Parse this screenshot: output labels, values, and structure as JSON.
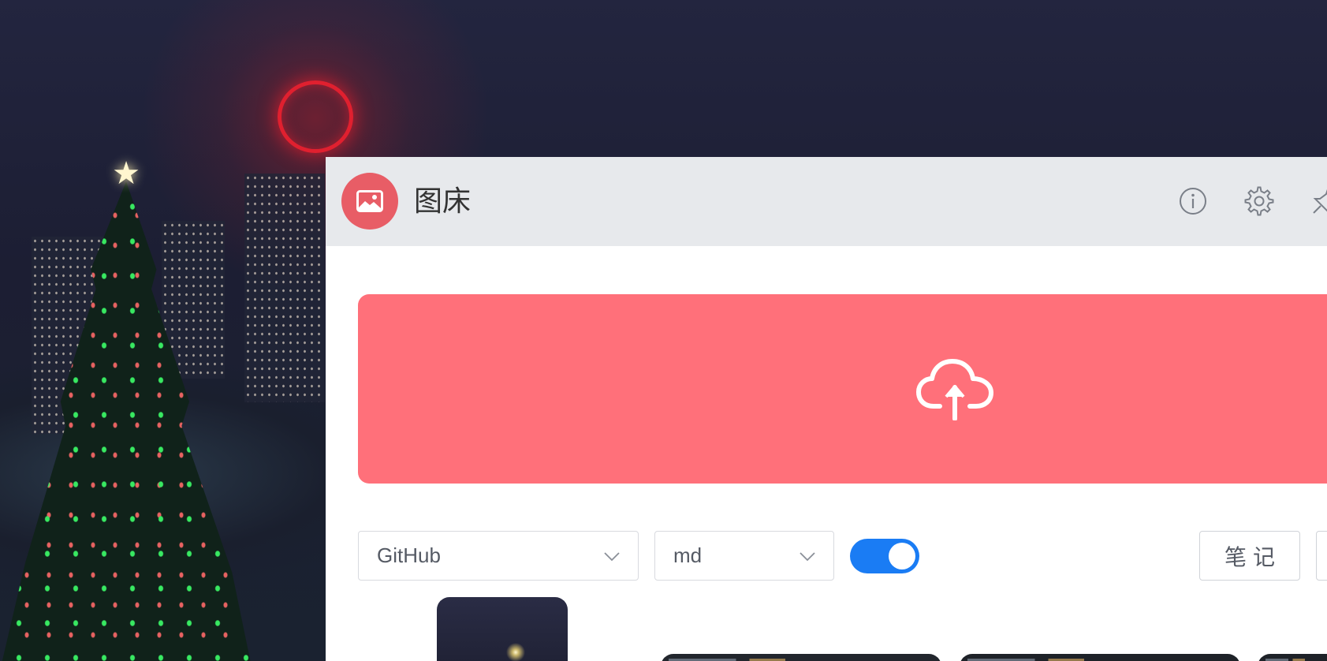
{
  "app": {
    "title": "图床"
  },
  "titlebar": {
    "info_icon": "info-icon",
    "settings_icon": "gear-icon",
    "pin_icon": "pin-icon"
  },
  "upload": {
    "icon": "cloud-upload-icon",
    "color": "#ff707a"
  },
  "controls": {
    "provider_value": "GitHub",
    "format_value": "md",
    "toggle_on": true,
    "notes_label": "笔记"
  },
  "colors": {
    "accent": "#1a7cf4",
    "logo": "#e85d66",
    "titlebar": "#e7e9ec"
  }
}
